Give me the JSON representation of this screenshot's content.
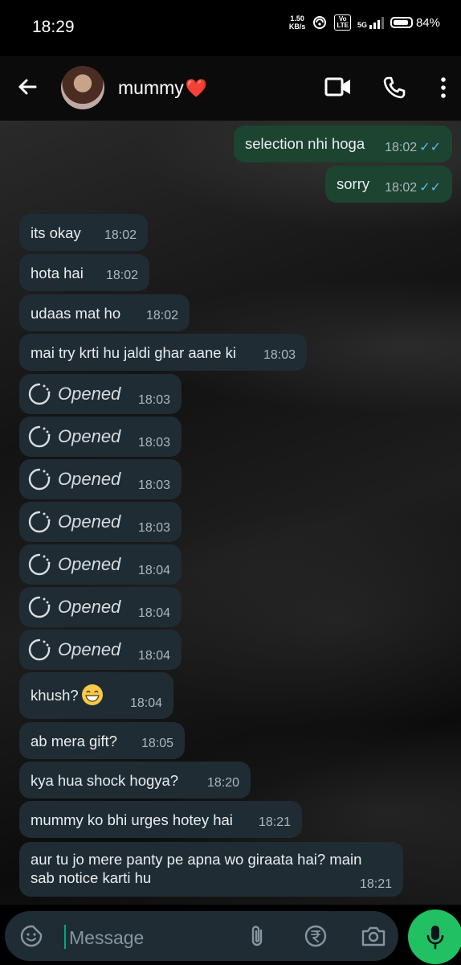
{
  "status_bar": {
    "time": "18:29",
    "net_speed_value": "1.50",
    "net_speed_unit": "KB/s",
    "volte_top": "Vo",
    "volte_bottom": "LTE",
    "network": "5G",
    "battery": "84%"
  },
  "header": {
    "contact_name": "mummy",
    "contact_emoji": "❤️"
  },
  "messages": [
    {
      "direction": "out",
      "text": "selection nhi hoga",
      "time": "18:02",
      "status": "read"
    },
    {
      "direction": "out",
      "text": "sorry",
      "time": "18:02",
      "status": "read"
    },
    {
      "direction": "in",
      "text": "its okay",
      "time": "18:02"
    },
    {
      "direction": "in",
      "text": "hota hai",
      "time": "18:02"
    },
    {
      "direction": "in",
      "text": "udaas mat ho",
      "time": "18:02"
    },
    {
      "direction": "in",
      "text": "mai try krti hu jaldi ghar aane ki",
      "time": "18:03"
    },
    {
      "direction": "in",
      "type": "view-once",
      "text": "Opened",
      "time": "18:03"
    },
    {
      "direction": "in",
      "type": "view-once",
      "text": "Opened",
      "time": "18:03"
    },
    {
      "direction": "in",
      "type": "view-once",
      "text": "Opened",
      "time": "18:03"
    },
    {
      "direction": "in",
      "type": "view-once",
      "text": "Opened",
      "time": "18:03"
    },
    {
      "direction": "in",
      "type": "view-once",
      "text": "Opened",
      "time": "18:04"
    },
    {
      "direction": "in",
      "type": "view-once",
      "text": "Opened",
      "time": "18:04"
    },
    {
      "direction": "in",
      "type": "view-once",
      "text": "Opened",
      "time": "18:04"
    },
    {
      "direction": "in",
      "text": "khush?",
      "emoji": "grinning-face",
      "time": "18:04"
    },
    {
      "direction": "in",
      "text": "ab mera gift?",
      "time": "18:05"
    },
    {
      "direction": "in",
      "text": "kya hua shock hogya?",
      "time": "18:20"
    },
    {
      "direction": "in",
      "text": "mummy ko bhi urges hotey hai",
      "time": "18:21"
    },
    {
      "direction": "in",
      "text_line1": "aur tu jo mere panty pe apna wo giraata hai? main",
      "text_line2": "sab notice karti hu",
      "time": "18:21"
    }
  ],
  "input": {
    "placeholder": "Message"
  },
  "colors": {
    "outgoing_bubble": "#1d4431",
    "incoming_bubble": "#202c33",
    "read_ticks": "#53bdeb",
    "mic_button": "#21c063",
    "heart": "#e02632"
  }
}
